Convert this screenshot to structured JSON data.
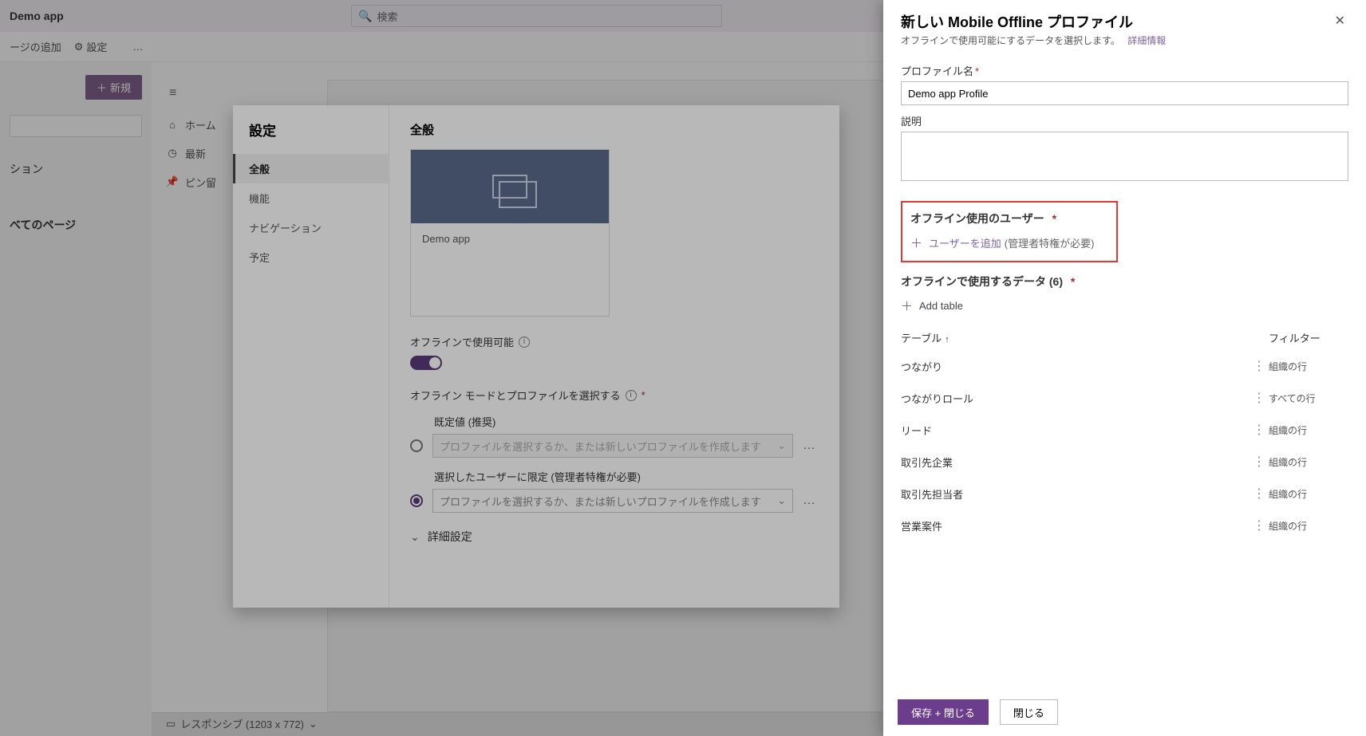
{
  "topbar": {
    "title": "Demo app",
    "search_placeholder": "検索"
  },
  "cmdbar": {
    "add_page": "ージの追加",
    "settings": "設定",
    "more": "…"
  },
  "leftcol": {
    "new": "新規",
    "sec1": "ション",
    "sec2": "べてのページ"
  },
  "sideicons": {
    "home": "ホーム",
    "recent": "最新",
    "pinned": "ピン留"
  },
  "responsive": {
    "label": "レスポンシブ (1203 x 772)"
  },
  "settings": {
    "title": "設定",
    "nav": {
      "general": "全般",
      "features": "機能",
      "navigation": "ナビゲーション",
      "upcoming": "予定"
    },
    "general_hdr": "全般",
    "tile_name": "Demo app",
    "offline_enable": "オフラインで使用可能",
    "mode_label": "オフライン モードとプロファイルを選択する",
    "r1_label": "既定値 (推奨)",
    "r2_label": "選択したユーザーに限定 (管理者特権が必要)",
    "profile_placeholder": "プロファイルを選択するか、または新しいプロファイルを作成します",
    "advanced": "詳細設定"
  },
  "panel": {
    "title": "新しい Mobile Offline プロファイル",
    "subtitle": "オフラインで使用可能にするデータを選択します。",
    "learn_more": "詳細情報",
    "profile_name_label": "プロファイル名",
    "profile_name_value": "Demo app Profile",
    "desc_label": "説明",
    "users_title": "オフライン使用のユーザー",
    "add_user": "ユーザーを追加",
    "add_user_hint": "(管理者特権が必要)",
    "data_title": "オフラインで使用するデータ",
    "data_count": "(6)",
    "add_table": "Add table",
    "col_table": "テーブル",
    "col_filter": "フィルター",
    "rows": [
      {
        "name": "つながり",
        "filter": "組織の行"
      },
      {
        "name": "つながりロール",
        "filter": "すべての行"
      },
      {
        "name": "リード",
        "filter": "組織の行"
      },
      {
        "name": "取引先企業",
        "filter": "組織の行"
      },
      {
        "name": "取引先担当者",
        "filter": "組織の行"
      },
      {
        "name": "営業案件",
        "filter": "組織の行"
      }
    ],
    "save_close": "保存 + 閉じる",
    "close": "閉じる"
  }
}
